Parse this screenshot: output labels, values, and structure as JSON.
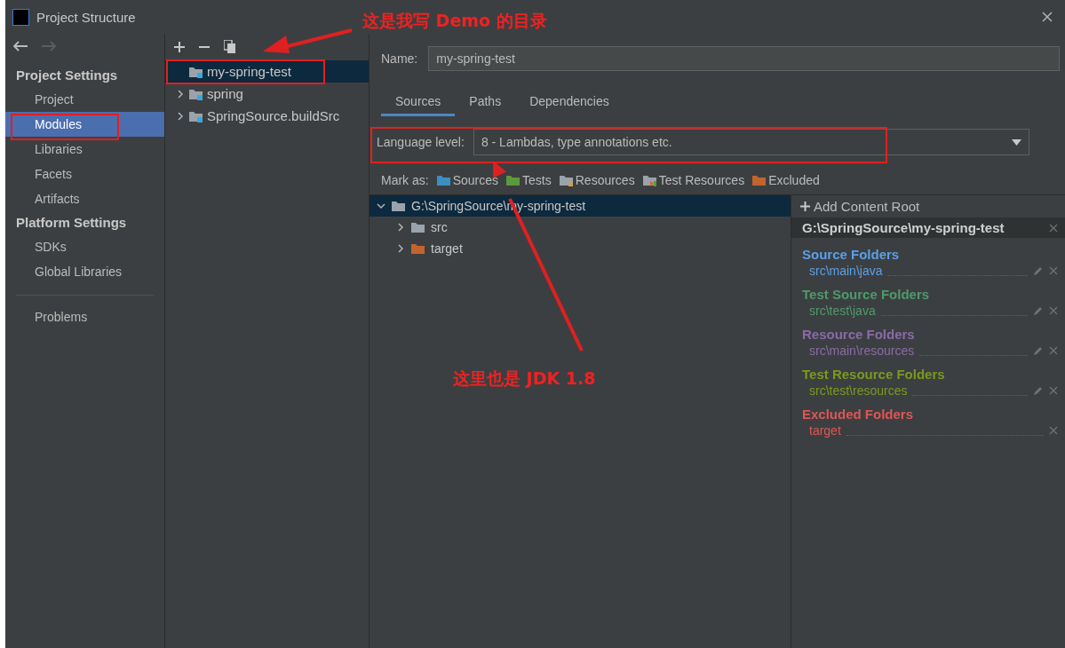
{
  "window": {
    "title": "Project Structure"
  },
  "sidebar": {
    "sections": [
      {
        "heading": "Project Settings",
        "items": [
          {
            "label": "Project",
            "selected": false
          },
          {
            "label": "Modules",
            "selected": true
          },
          {
            "label": "Libraries",
            "selected": false
          },
          {
            "label": "Facets",
            "selected": false
          },
          {
            "label": "Artifacts",
            "selected": false
          }
        ]
      },
      {
        "heading": "Platform Settings",
        "items": [
          {
            "label": "SDKs",
            "selected": false
          },
          {
            "label": "Global Libraries",
            "selected": false
          }
        ]
      }
    ],
    "extra_items": [
      {
        "label": "Problems",
        "selected": false
      }
    ]
  },
  "modules": {
    "items": [
      {
        "name": "my-spring-test",
        "selected": true,
        "expandable": false
      },
      {
        "name": "spring",
        "selected": false,
        "expandable": true
      },
      {
        "name": "SpringSource.buildSrc",
        "selected": false,
        "expandable": true
      }
    ]
  },
  "details": {
    "name_label": "Name:",
    "name_value": "my-spring-test",
    "tabs": [
      {
        "label": "Sources",
        "selected": true
      },
      {
        "label": "Paths",
        "selected": false
      },
      {
        "label": "Dependencies",
        "selected": false
      }
    ],
    "language_label": "Language level:",
    "language_value": "8 - Lambdas, type annotations etc.",
    "mark_label": "Mark as:",
    "marks": [
      {
        "label": "Sources",
        "kind": "sources"
      },
      {
        "label": "Tests",
        "kind": "tests"
      },
      {
        "label": "Resources",
        "kind": "resources"
      },
      {
        "label": "Test Resources",
        "kind": "test-resources"
      },
      {
        "label": "Excluded",
        "kind": "excluded"
      }
    ],
    "tree": {
      "label": "G:\\SpringSource\\my-spring-test",
      "expanded": true,
      "selected": true,
      "children": [
        {
          "label": "src",
          "kind": "plain",
          "expanded": false
        },
        {
          "label": "target",
          "kind": "excluded",
          "expanded": false
        }
      ]
    },
    "content": {
      "add_label": "Add Content Root",
      "root": "G:\\SpringSource\\my-spring-test",
      "groups": [
        {
          "title": "Source Folders",
          "color": "#5c9fe8",
          "folders": [
            {
              "path": "src\\main\\java",
              "editable": true
            }
          ]
        },
        {
          "title": "Test Source Folders",
          "color": "#4e9a6a",
          "folders": [
            {
              "path": "src\\test\\java",
              "editable": true
            }
          ]
        },
        {
          "title": "Resource Folders",
          "color": "#8a6aa8",
          "folders": [
            {
              "path": "src\\main\\resources",
              "editable": true
            }
          ]
        },
        {
          "title": "Test Resource Folders",
          "color": "#7a9a1c",
          "folders": [
            {
              "path": "src\\test\\resources",
              "editable": true
            }
          ]
        },
        {
          "title": "Excluded Folders",
          "color": "#e05555",
          "folders": [
            {
              "path": "target",
              "editable": false
            }
          ]
        }
      ]
    }
  },
  "annotations": [
    {
      "text": "这是我写 Demo 的目录"
    },
    {
      "text": "这里也是 JDK 1.8"
    }
  ]
}
